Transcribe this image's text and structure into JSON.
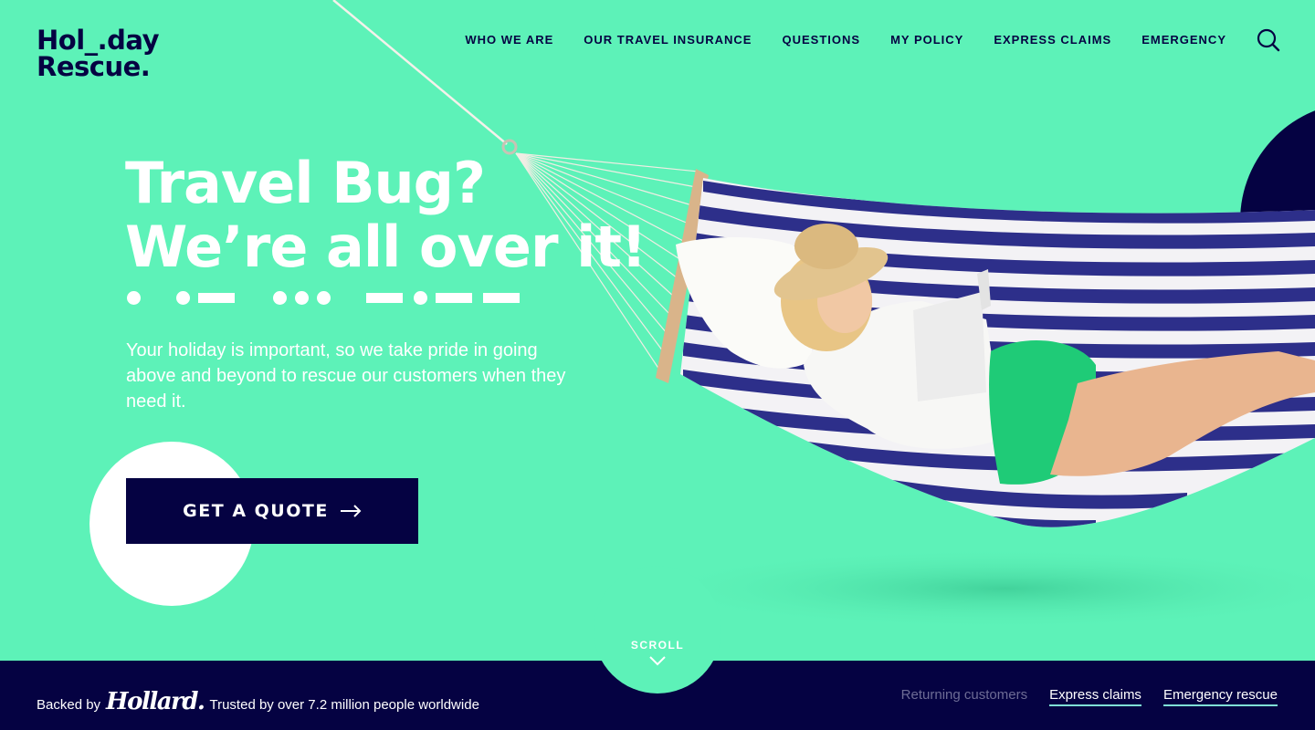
{
  "brand": {
    "logo_line1": "Hol_.day",
    "logo_line2": "Rescue.",
    "colors": {
      "mint": "#5df2b8",
      "navy": "#050242",
      "white": "#ffffff",
      "link_underline": "#7fe0d6"
    }
  },
  "nav": {
    "items": [
      {
        "label": "WHO WE ARE"
      },
      {
        "label": "OUR TRAVEL INSURANCE"
      },
      {
        "label": "QUESTIONS"
      },
      {
        "label": "MY POLICY"
      },
      {
        "label": "EXPRESS CLAIMS"
      },
      {
        "label": "EMERGENCY"
      }
    ],
    "search_icon": "search-icon"
  },
  "hero": {
    "title_line1": "Travel Bug?",
    "title_line2": "We’re all over it!",
    "morse_pattern": [
      "dot",
      "gap",
      "dot",
      "dash",
      "gap",
      "dot",
      "dot",
      "dot",
      "gap",
      "dash",
      "dot",
      "dash",
      "dash"
    ],
    "subtitle": "Your holiday is important, so we take pride in going above and beyond to rescue our customers when they need it.",
    "cta_label": "GET A QUOTE",
    "cta_icon": "arrow-right-icon",
    "image_alt": "Woman reading a book in a striped hammock"
  },
  "scroll": {
    "label": "SCROLL",
    "icon": "chevron-down-icon"
  },
  "footer": {
    "backed_by": "Backed by",
    "partner": "Hollard.",
    "trusted": "Trusted by over 7.2 million people worldwide",
    "links": [
      {
        "label": "Returning customers"
      },
      {
        "label": "Express claims"
      },
      {
        "label": "Emergency rescue"
      }
    ]
  }
}
